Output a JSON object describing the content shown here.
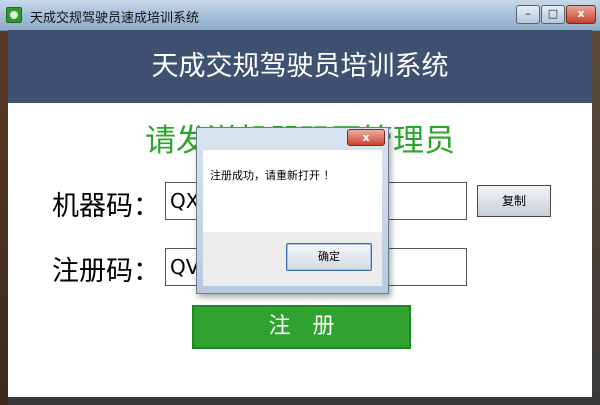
{
  "window": {
    "title": "天成交规驾驶员速成培训系统",
    "controls": {
      "minimize": "–",
      "maximize": "□",
      "close": "x"
    }
  },
  "header": {
    "title": "天成交规驾驶员培训系统"
  },
  "main": {
    "prompt": "请发送机器码至管理员",
    "machine_code": {
      "label": "机器码：",
      "value": "QX"
    },
    "copy_button": "复制",
    "registration_code": {
      "label": "注册码：",
      "value": "QV"
    },
    "register_button": "注册"
  },
  "dialog": {
    "message": "注册成功，请重新打开 ！",
    "ok_button": "确定",
    "close": "x"
  },
  "colors": {
    "header_band": "#3f5170",
    "prompt_green": "#2aa52a",
    "register_green": "#2fa22f"
  }
}
